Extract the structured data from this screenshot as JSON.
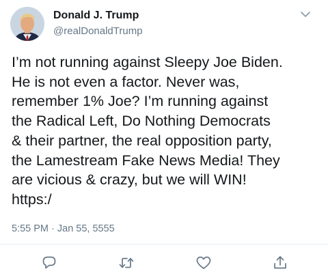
{
  "user": {
    "display_name": "Donald J. Trump",
    "handle": "@realDonaldTrump",
    "avatar_icon": "profile-photo"
  },
  "tweet": {
    "text": "I’m not running against Sleepy Joe Biden.\nHe is not even a factor. Never was,\nremember 1% Joe? I’m running against\nthe Radical Left, Do Nothing Democrats\n& their partner, the real opposition party,\nthe Lamestream Fake News Media! They\nare vicious & crazy, but we will WIN!\nhttps:/",
    "timestamp": "5:55 PM · Jan 55, 5555"
  },
  "actions": {
    "reply_icon": "reply-icon",
    "retweet_icon": "retweet-icon",
    "like_icon": "heart-icon",
    "share_icon": "share-icon",
    "more_icon": "chevron-down-icon"
  },
  "colors": {
    "text": "#14171a",
    "secondary": "#657786",
    "divider": "#e6ecf0"
  }
}
